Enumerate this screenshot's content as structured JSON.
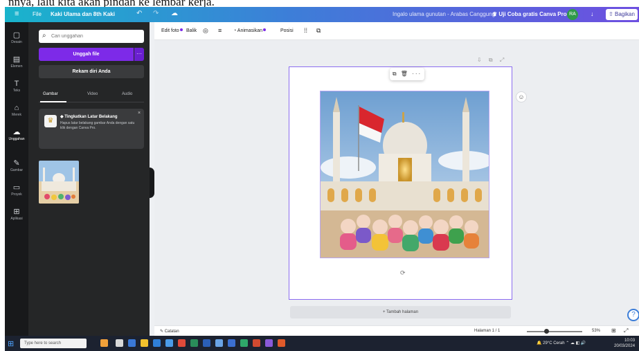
{
  "caption": {
    "text": "nnya, lalu kita akan pindah ke lembar kerja."
  },
  "topbar": {
    "file_label": "File",
    "doc_title": "Kaki Ulama dan 8th Kaki",
    "note": "Ingalo ulama gunutan - Arabas Canggung",
    "trial_label": "♛ Uji Coba gratis Canva Pro",
    "avatar_initials": "RA",
    "stats": "↓",
    "share_label": "⇧ Bagikan"
  },
  "rail": {
    "items": [
      {
        "icon": "▢",
        "label": "Desain"
      },
      {
        "icon": "▤",
        "label": "Elemen"
      },
      {
        "icon": "T",
        "label": "Teks"
      },
      {
        "icon": "⌂",
        "label": "Merek"
      },
      {
        "icon": "☁",
        "label": "Unggahan"
      },
      {
        "icon": "✎",
        "label": "Gambar"
      },
      {
        "icon": "▭",
        "label": "Proyek"
      },
      {
        "icon": "⊞",
        "label": "Aplikasi"
      }
    ]
  },
  "panel": {
    "search_placeholder": "Cari unggahan",
    "upload_label": "Unggah file",
    "upload_more": "···",
    "record_label": "Rekam diri Anda",
    "tabs": [
      "Gambar",
      "Video",
      "Audio"
    ],
    "notice_title": "◆ Tingkatkan Latar Belakang",
    "notice_body": "Hapus latar belakang gambar Anda dengan satu klik dengan Canva Pro.",
    "notice_close": "×"
  },
  "toolbar": {
    "edit_photo": "Edit foto",
    "crop": "Balik",
    "animate": "Animasikan",
    "position": "Posisi"
  },
  "canvas": {
    "page_tools": "⇩ ⧉ ⤢",
    "float_tools": "⧉ 🗑 ···",
    "rotate": "⟳",
    "comment": "☺",
    "add_page": "+ Tambah halaman",
    "help": "?"
  },
  "bottombar": {
    "notes": "✎ Catatan",
    "page_indicator": "Halaman 1 / 1",
    "zoom": "53%",
    "zoom_level": 0.35,
    "grid": "⊞",
    "fullscreen": "⤢"
  },
  "taskbar": {
    "search_placeholder": "Type here to search",
    "tray": "🔔 29°C Cerah  ⌃ ☁ ◧ 🔊",
    "time": "10:03",
    "date": "20/03/2024"
  },
  "colors": {
    "accent": "#7d2ae8",
    "selection": "#8b6cf0",
    "rail_bg": "#18191b",
    "panel_bg": "#252627"
  }
}
